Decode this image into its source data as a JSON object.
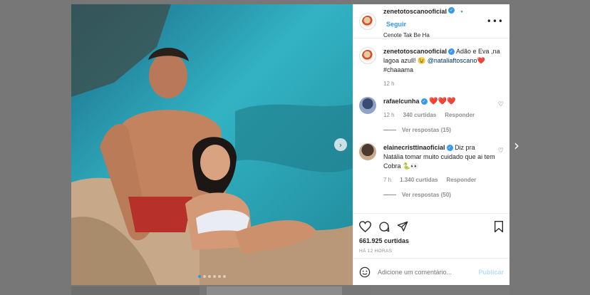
{
  "post": {
    "author": "zenetotoscanooficial",
    "follow_label": "Seguir",
    "location": "Cenote Tak Be Ha",
    "caption_text": "Adão e Eva ,na lagoa azull! 😉",
    "caption_mention": "@nataliaftoscano",
    "caption_tail": "❤️#chaaama",
    "caption_time": "12 h",
    "likes": "661.925 curtidas",
    "time_ago": "HÁ 12 HORAS"
  },
  "comments": [
    {
      "user": "rafaelcunha",
      "text": "❤️❤️❤️",
      "time": "12 h",
      "likes": "340 curtidas",
      "reply_label": "Responder",
      "view_replies": "Ver respostas (15)"
    },
    {
      "user": "elainecristtinaoficial",
      "text": "Diz pra Natália tomar muito cuidado que ai tem Cobra 🐍👀",
      "time": "7 h",
      "likes": "1.340 curtidas",
      "reply_label": "Responder",
      "view_replies": "Ver respostas (50)"
    }
  ],
  "comment_box": {
    "placeholder": "Adicione um comentário...",
    "publish_label": "Publicar"
  },
  "icons": {
    "more": "more-options-icon",
    "like": "heart-icon",
    "comment": "comment-icon",
    "share": "paper-plane-icon",
    "save": "bookmark-icon",
    "emoji": "emoji-icon",
    "next_photo": "chevron-right-icon",
    "next_post": "next-post-arrow-icon"
  },
  "colors": {
    "link_blue": "#3897f0",
    "heart_red": "#ed4956",
    "muted": "#8e8e8e"
  }
}
